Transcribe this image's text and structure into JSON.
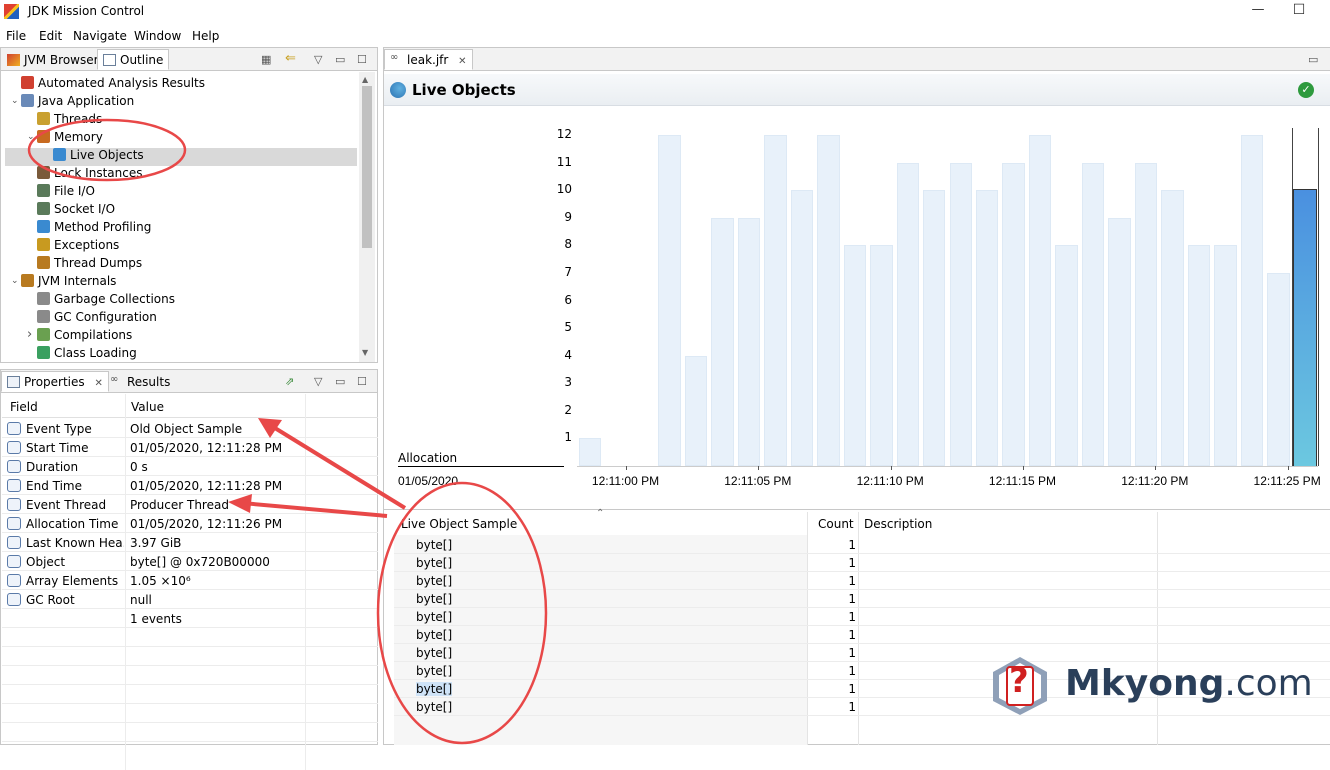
{
  "window": {
    "title": "JDK Mission Control",
    "minimize": "—",
    "maximize": "☐"
  },
  "menu": [
    "File",
    "Edit",
    "Navigate",
    "Window",
    "Help"
  ],
  "left_top": {
    "tabs": [
      "JVM Browser",
      "Outline"
    ],
    "tree": [
      {
        "label": "Automated Analysis Results",
        "icon": "analysis-icon"
      },
      {
        "label": "Java Application",
        "icon": "java-app-icon"
      },
      {
        "label": "Threads",
        "icon": "threads-icon"
      },
      {
        "label": "Memory",
        "icon": "memory-icon"
      },
      {
        "label": "Live Objects",
        "icon": "live-objects-icon"
      },
      {
        "label": "Lock Instances",
        "icon": "lock-icon"
      },
      {
        "label": "File I/O",
        "icon": "file-io-icon"
      },
      {
        "label": "Socket I/O",
        "icon": "socket-io-icon"
      },
      {
        "label": "Method Profiling",
        "icon": "method-profiling-icon"
      },
      {
        "label": "Exceptions",
        "icon": "exceptions-icon"
      },
      {
        "label": "Thread Dumps",
        "icon": "thread-dumps-icon"
      },
      {
        "label": "JVM Internals",
        "icon": "jvm-internals-icon"
      },
      {
        "label": "Garbage Collections",
        "icon": "gc-icon"
      },
      {
        "label": "GC Configuration",
        "icon": "gc-config-icon"
      },
      {
        "label": "Compilations",
        "icon": "compilations-icon"
      },
      {
        "label": "Class Loading",
        "icon": "class-loading-icon"
      }
    ]
  },
  "left_bottom": {
    "tabs": [
      "Properties",
      "Results"
    ],
    "headers": {
      "field": "Field",
      "value": "Value"
    },
    "rows": [
      {
        "field": "Event Type",
        "value": "Old Object Sample"
      },
      {
        "field": "Start Time",
        "value": "01/05/2020, 12:11:28 PM"
      },
      {
        "field": "Duration",
        "value": "0 s"
      },
      {
        "field": "End Time",
        "value": "01/05/2020, 12:11:28 PM"
      },
      {
        "field": "Event Thread",
        "value": "Producer Thread"
      },
      {
        "field": "Allocation Time",
        "value": "01/05/2020, 12:11:26 PM"
      },
      {
        "field": "Last Known Hea...",
        "value": "3.97 GiB"
      },
      {
        "field": "Object",
        "value": "byte[] @ 0x720B00000"
      },
      {
        "field": "Array Elements",
        "value": "1.05 ×10⁶"
      },
      {
        "field": "GC Root",
        "value": "null"
      }
    ],
    "footer": "1 events"
  },
  "editor": {
    "tab": "leak.jfr",
    "title": "Live Objects",
    "chart_label": "Allocation",
    "date_label": "01/05/2020",
    "list_headers": {
      "sample": "Live Object Sample",
      "count": "Count",
      "description": "Description"
    },
    "rows": [
      {
        "name": "byte[]",
        "count": "1"
      },
      {
        "name": "byte[]",
        "count": "1"
      },
      {
        "name": "byte[]",
        "count": "1"
      },
      {
        "name": "byte[]",
        "count": "1"
      },
      {
        "name": "byte[]",
        "count": "1"
      },
      {
        "name": "byte[]",
        "count": "1"
      },
      {
        "name": "byte[]",
        "count": "1"
      },
      {
        "name": "byte[]",
        "count": "1"
      },
      {
        "name": "byte[]",
        "count": "1"
      },
      {
        "name": "byte[]",
        "count": "1"
      }
    ]
  },
  "chart_data": {
    "type": "bar",
    "title": "",
    "xlabel": "",
    "ylabel": "Allocation",
    "ylim": [
      0,
      12
    ],
    "yticks": [
      "1",
      "2",
      "3",
      "4",
      "5",
      "6",
      "7",
      "8",
      "9",
      "10",
      "11",
      "12"
    ],
    "xticks": [
      "12:11:00 PM",
      "12:11:05 PM",
      "12:11:10 PM",
      "12:11:15 PM",
      "12:11:20 PM",
      "12:11:25 PM"
    ],
    "values": [
      1,
      0,
      0,
      12,
      4,
      9,
      9,
      12,
      10,
      12,
      8,
      8,
      11,
      10,
      11,
      10,
      11,
      12,
      8,
      11,
      9,
      11,
      10,
      8,
      8,
      12,
      7,
      10
    ],
    "highlight_index": 27,
    "colors": {
      "bar": "#e8f1fa",
      "selected_top": "#4a90e0",
      "selected_bottom": "#6cc8e0"
    }
  },
  "watermark": {
    "brand": "Mkyong",
    "suffix": ".com",
    "symbol": "?"
  }
}
